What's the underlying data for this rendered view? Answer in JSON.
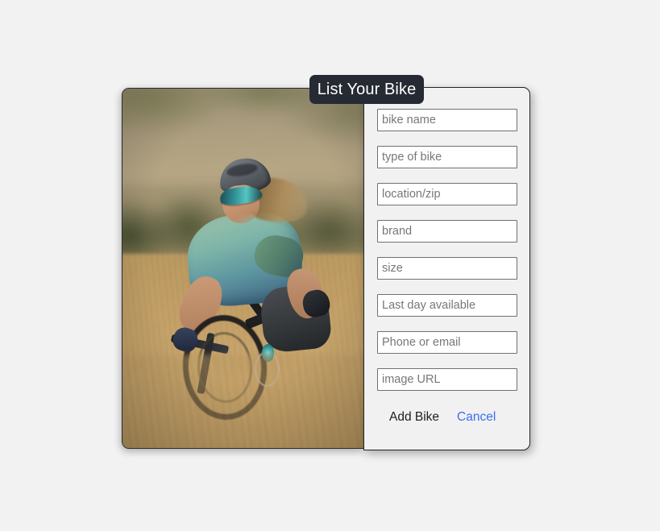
{
  "page": {
    "background_color": "#f2f2f2"
  },
  "dialog": {
    "title": "List Your Bike",
    "title_badge_color": "#262a33",
    "panel_color": "#f1f1f1",
    "photo": {
      "alt": "Woman mountain biking through dry golden grass on a hillside",
      "subject": "cyclist-on-mountain-bike",
      "scene_colors": {
        "grass": "#c2a06a",
        "hillside": "#ab9d7f",
        "shrub": "#3f4a2a",
        "jersey": "#7fb5a8",
        "helmet": "#5d6268",
        "glasses": "#56c5c2"
      }
    },
    "fields": [
      {
        "name": "bike-name",
        "placeholder": "bike name",
        "value": ""
      },
      {
        "name": "type-of-bike",
        "placeholder": "type of bike",
        "value": ""
      },
      {
        "name": "location-zip",
        "placeholder": "location/zip",
        "value": ""
      },
      {
        "name": "brand",
        "placeholder": "brand",
        "value": ""
      },
      {
        "name": "size",
        "placeholder": "size",
        "value": ""
      },
      {
        "name": "last-day",
        "placeholder": "Last day available",
        "value": ""
      },
      {
        "name": "contact",
        "placeholder": "Phone or email",
        "value": ""
      },
      {
        "name": "image-url",
        "placeholder": "image URL",
        "value": ""
      }
    ],
    "actions": {
      "submit_label": "Add Bike",
      "cancel_label": "Cancel",
      "cancel_color": "#3c6cf0"
    }
  }
}
